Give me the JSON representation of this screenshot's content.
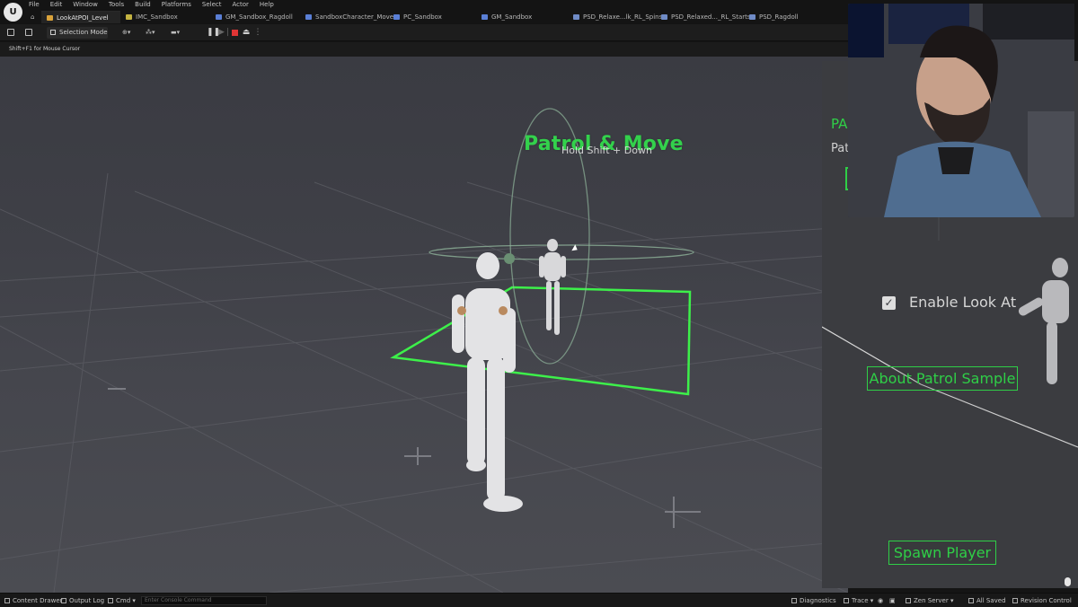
{
  "menu": [
    "File",
    "Edit",
    "Window",
    "Tools",
    "Build",
    "Platforms",
    "Select",
    "Actor",
    "Help"
  ],
  "tabs": [
    {
      "label": "LookAtPOI_Level",
      "color": "#d9a23a",
      "active": true
    },
    {
      "label": "IMC_Sandbox",
      "color": "#c4b341",
      "active": false
    },
    {
      "label": "GM_Sandbox_Ragdoll",
      "color": "#5a7fd6",
      "active": false
    },
    {
      "label": "SandboxCharacter_Mover",
      "color": "#5a7fd6",
      "active": false
    },
    {
      "label": "PC_Sandbox",
      "color": "#5a7fd6",
      "active": false
    },
    {
      "label": "GM_Sandbox",
      "color": "#5a7fd6",
      "active": false
    },
    {
      "label": "PSD_Relaxe...lk_RL_Spins",
      "color": "#6f8bc6",
      "active": false
    },
    {
      "label": "PSD_Relaxed..._RL_Starts",
      "color": "#6f8bc6",
      "active": false
    },
    {
      "label": "PSD_Ragdoll",
      "color": "#6f8bc6",
      "active": false
    }
  ],
  "toolbar": {
    "selection_mode": "Selection Mode"
  },
  "viewport": {
    "hint": "Shift+F1 for Mouse Cursor",
    "title_3d": "Patrol & Move",
    "hold_hint": "Hold Shift + Down"
  },
  "ui_panel": {
    "header": "PA",
    "sub": "Patr",
    "enable_look_at": "Enable Look At",
    "about_button": "About Patrol Sample",
    "spawn_button": "Spawn Player",
    "look_at_checked": true
  },
  "statusbar": {
    "content_drawer": "Content Drawer",
    "output_log": "Output Log",
    "cmd": "Cmd",
    "console_placeholder": "Enter Console Command",
    "diagnostics": "Diagnostics",
    "trace": "Trace",
    "zen_server": "Zen Server",
    "all_saved": "All Saved",
    "revision_control": "Revision Control"
  },
  "colors": {
    "accent_green": "#2fcf47",
    "title_green": "#33d14c"
  }
}
